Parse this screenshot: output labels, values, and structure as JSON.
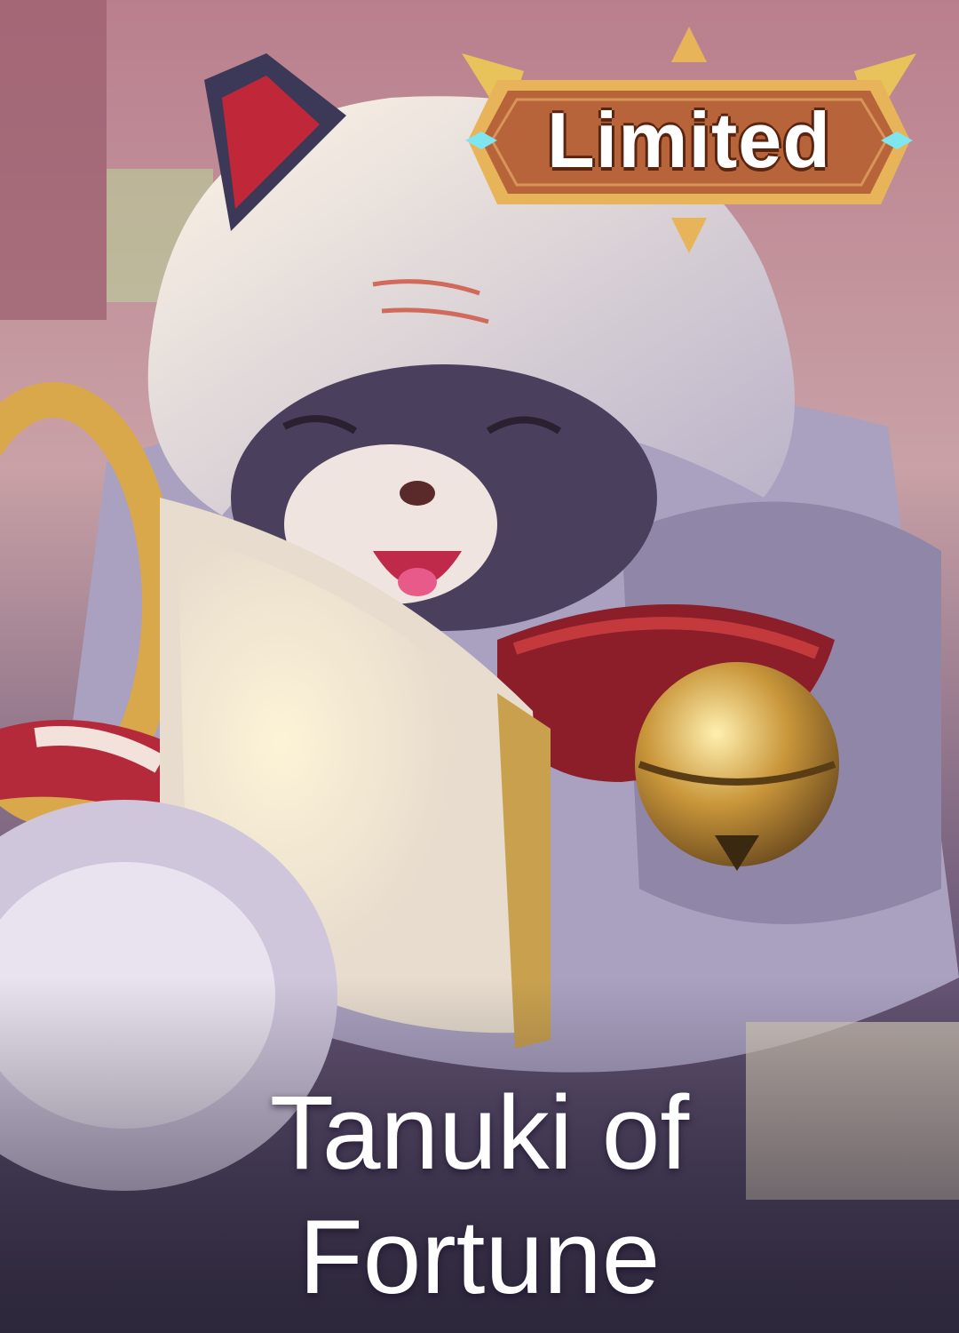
{
  "card": {
    "badge_label": "Limited",
    "title_line1": "Tanuki of",
    "title_line2": "Fortune",
    "art_icon": "tanuki-mascot-illustration",
    "colors": {
      "badge_fill": "#b8643a",
      "badge_border": "#e8b45a",
      "badge_gem": "#7fe6f0",
      "title_text": "#ffffff"
    }
  }
}
